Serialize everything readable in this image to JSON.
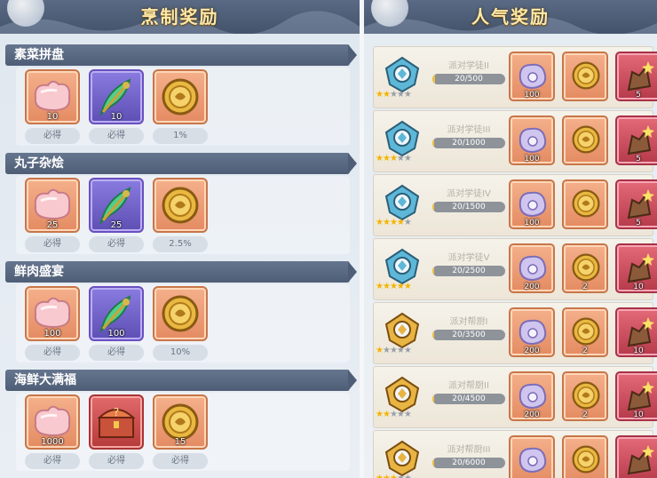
{
  "left_panel": {
    "title": "烹制奖励",
    "recipes": [
      {
        "name": "素菜拼盘",
        "items": [
          {
            "icon": "pink-bun-icon",
            "bg": "peach",
            "qty": "10",
            "chance": "必得"
          },
          {
            "icon": "green-feather-icon",
            "bg": "purple",
            "qty": "10",
            "chance": "必得"
          },
          {
            "icon": "gold-coin-icon",
            "bg": "peach",
            "qty": "",
            "chance": "1%"
          }
        ]
      },
      {
        "name": "丸子杂烩",
        "items": [
          {
            "icon": "pink-bun-icon",
            "bg": "peach",
            "qty": "25",
            "chance": "必得"
          },
          {
            "icon": "green-feather-icon",
            "bg": "purple",
            "qty": "25",
            "chance": "必得"
          },
          {
            "icon": "gold-coin-icon",
            "bg": "peach",
            "qty": "",
            "chance": "2.5%"
          }
        ]
      },
      {
        "name": "鲜肉盛宴",
        "items": [
          {
            "icon": "pink-bun-icon",
            "bg": "peach",
            "qty": "100",
            "chance": "必得"
          },
          {
            "icon": "green-feather-icon",
            "bg": "purple",
            "qty": "100",
            "chance": "必得"
          },
          {
            "icon": "gold-coin-icon",
            "bg": "peach",
            "qty": "",
            "chance": "10%"
          }
        ]
      },
      {
        "name": "海鲜大满福",
        "items": [
          {
            "icon": "pink-bun-icon",
            "bg": "peach",
            "qty": "1000",
            "chance": "必得"
          },
          {
            "icon": "treasure-chest-icon",
            "bg": "red",
            "qty": "",
            "chance": "必得"
          },
          {
            "icon": "gold-coin-icon",
            "bg": "peach",
            "qty": "15",
            "chance": "必得"
          }
        ]
      }
    ]
  },
  "right_panel": {
    "title": "人气奖励",
    "tiers": [
      {
        "rank": "派对学徒II",
        "stars": 2,
        "badge": "blue",
        "progress": "20/500",
        "progress_fraction": 0.04,
        "rewards": [
          {
            "icon": "shell-icon",
            "qty": "100"
          },
          {
            "icon": "gold-coin-icon",
            "qty": ""
          },
          {
            "icon": "star-fragment-icon",
            "qty": "5"
          }
        ]
      },
      {
        "rank": "派对学徒III",
        "stars": 3,
        "badge": "blue",
        "progress": "20/1000",
        "progress_fraction": 0.02,
        "rewards": [
          {
            "icon": "shell-icon",
            "qty": "100"
          },
          {
            "icon": "gold-coin-icon",
            "qty": ""
          },
          {
            "icon": "star-fragment-icon",
            "qty": "5"
          }
        ]
      },
      {
        "rank": "派对学徒IV",
        "stars": 4,
        "badge": "blue",
        "progress": "20/1500",
        "progress_fraction": 0.013,
        "rewards": [
          {
            "icon": "shell-icon",
            "qty": "100"
          },
          {
            "icon": "gold-coin-icon",
            "qty": ""
          },
          {
            "icon": "star-fragment-icon",
            "qty": "5"
          }
        ]
      },
      {
        "rank": "派对学徒V",
        "stars": 5,
        "badge": "blue",
        "progress": "20/2500",
        "progress_fraction": 0.008,
        "rewards": [
          {
            "icon": "shell-icon",
            "qty": "200"
          },
          {
            "icon": "gold-coin-icon",
            "qty": "2"
          },
          {
            "icon": "star-fragment-icon",
            "qty": "10"
          }
        ]
      },
      {
        "rank": "派对帮厨I",
        "stars": 1,
        "badge": "gold",
        "progress": "20/3500",
        "progress_fraction": 0.006,
        "rewards": [
          {
            "icon": "shell-icon",
            "qty": "200"
          },
          {
            "icon": "gold-coin-icon",
            "qty": "2"
          },
          {
            "icon": "star-fragment-icon",
            "qty": "10"
          }
        ]
      },
      {
        "rank": "派对帮厨II",
        "stars": 2,
        "badge": "gold",
        "progress": "20/4500",
        "progress_fraction": 0.004,
        "rewards": [
          {
            "icon": "shell-icon",
            "qty": "200"
          },
          {
            "icon": "gold-coin-icon",
            "qty": "2"
          },
          {
            "icon": "star-fragment-icon",
            "qty": "10"
          }
        ]
      },
      {
        "rank": "派对帮厨III",
        "stars": 3,
        "badge": "gold",
        "progress": "20/6000",
        "progress_fraction": 0.003,
        "rewards": [
          {
            "icon": "shell-icon",
            "qty": ""
          },
          {
            "icon": "gold-coin-icon",
            "qty": ""
          },
          {
            "icon": "star-fragment-icon",
            "qty": ""
          }
        ]
      }
    ]
  }
}
